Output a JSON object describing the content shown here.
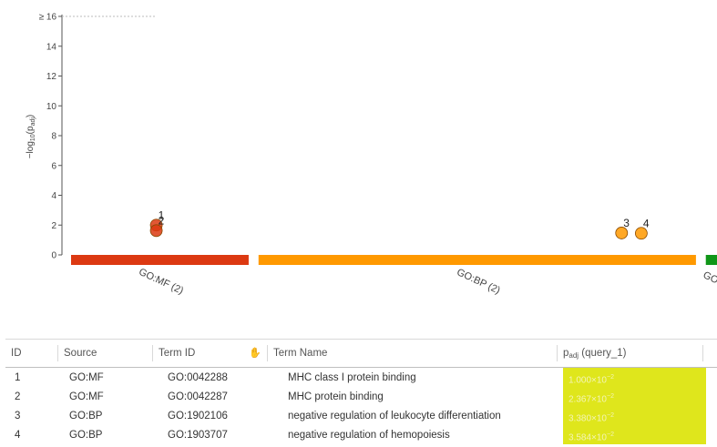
{
  "chart_data": {
    "type": "scatter",
    "ylabel_prefix": "−log",
    "ylabel_base": "10",
    "ylabel_p": "p",
    "ylabel_sub": "adj",
    "ylim": [
      0,
      16
    ],
    "y_ticks": [
      {
        "value": 0,
        "label": "0"
      },
      {
        "value": 2,
        "label": "2"
      },
      {
        "value": 4,
        "label": "4"
      },
      {
        "value": 6,
        "label": "6"
      },
      {
        "value": 8,
        "label": "8"
      },
      {
        "value": 10,
        "label": "10"
      },
      {
        "value": 12,
        "label": "12"
      },
      {
        "value": 14,
        "label": "14"
      },
      {
        "value": 16,
        "label": "≥ 16"
      }
    ],
    "sources": [
      {
        "name": "GO:MF (2)",
        "color": "#dc3912",
        "start": 0,
        "end": 0.27
      },
      {
        "name": "GO:BP (2)",
        "color": "#ff9900",
        "start": 0.285,
        "end": 0.95
      },
      {
        "name": "GO:CC",
        "color": "#109618",
        "start": 0.965,
        "end": 1.0
      }
    ],
    "points": [
      {
        "id": "1",
        "source": "GO:MF",
        "y": 2.0,
        "color": "#dc3912"
      },
      {
        "id": "2",
        "source": "GO:MF",
        "y": 1.63,
        "color": "#dc3912"
      },
      {
        "id": "3",
        "source": "GO:BP",
        "y": 1.47,
        "color": "#ff9900"
      },
      {
        "id": "4",
        "source": "GO:BP",
        "y": 1.45,
        "color": "#ff9900"
      }
    ]
  },
  "table": {
    "headers": {
      "id": "ID",
      "source": "Source",
      "term_id": "Term ID",
      "term_name": "Term Name",
      "p_base": "p",
      "p_sub": "adj",
      "p_query": "(query_1)"
    },
    "rows": [
      {
        "id": "1",
        "source": "GO:MF",
        "term_id": "GO:0042288",
        "term_name": "MHC class I protein binding",
        "p_mant": "1.000",
        "p_exp": "−2",
        "p_value": 0.01
      },
      {
        "id": "2",
        "source": "GO:MF",
        "term_id": "GO:0042287",
        "term_name": "MHC protein binding",
        "p_mant": "2.367",
        "p_exp": "−2",
        "p_value": 0.02367
      },
      {
        "id": "3",
        "source": "GO:BP",
        "term_id": "GO:1902106",
        "term_name": "negative regulation of leukocyte differentiation",
        "p_mant": "3.380",
        "p_exp": "−2",
        "p_value": 0.0338
      },
      {
        "id": "4",
        "source": "GO:BP",
        "term_id": "GO:1903707",
        "term_name": "negative regulation of hemopoiesis",
        "p_mant": "3.584",
        "p_exp": "−2",
        "p_value": 0.03584
      }
    ],
    "highlight_color": "#dfe61c"
  }
}
